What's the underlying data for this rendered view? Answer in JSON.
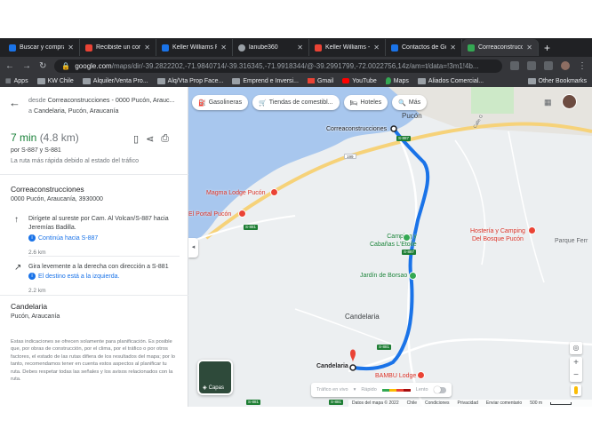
{
  "browser": {
    "tabs": [
      {
        "label": "Buscar y compra",
        "color": "#1a73e8"
      },
      {
        "label": "Recibiste un cor",
        "color": "#ea4335"
      },
      {
        "label": "Keller Williams R",
        "color": "#1a73e8"
      },
      {
        "label": "lanube360",
        "color": "#9aa0a6"
      },
      {
        "label": "Keller Williams -",
        "color": "#ea4335"
      },
      {
        "label": "Contactos de Go",
        "color": "#1a73e8"
      },
      {
        "label": "Correaconstrucc",
        "color": "#34a853"
      }
    ],
    "new_tab": "+",
    "url_host": "google.com",
    "url_path": "/maps/dir/-39.2822202,-71.9840714/-39.316345,-71.9918344/@-39.2991799,-72.0022756,14z/am=t/data=!3m1!4b...",
    "bookmarks": [
      {
        "label": "Apps",
        "icon": "apps-icon"
      },
      {
        "label": "KW Chile",
        "icon": "folder-icon"
      },
      {
        "label": "Alquiler/Venta Pro...",
        "icon": "folder-icon"
      },
      {
        "label": "Alq/Vta Prop Face...",
        "icon": "folder-icon"
      },
      {
        "label": "Emprend e Inversi...",
        "icon": "folder-icon"
      },
      {
        "label": "Gmail",
        "icon": "gmail-icon"
      },
      {
        "label": "YouTube",
        "icon": "youtube-icon"
      },
      {
        "label": "Maps",
        "icon": "maps-icon"
      },
      {
        "label": "Aliados Comercial...",
        "icon": "folder-icon"
      }
    ],
    "other_bookmarks": "Other Bookmarks"
  },
  "panel": {
    "route_prefix": "desde ",
    "route_origin": "Correaconstrucciones - 0000 Pucón, Arauc...",
    "route_mid": " a ",
    "route_destination": "Candelaria, Pucón, Araucanía",
    "duration": "7 min",
    "distance": "(4.8 km)",
    "via": "por S-887 y S-881",
    "faster_note": "La ruta más rápida debido al estado del tráfico",
    "origin_name": "Correaconstrucciones",
    "origin_address": "0000 Pucón, Araucanía, 3930000",
    "steps": [
      {
        "icon": "↑",
        "text": "Dirígete al sureste por Cam. Al Volcan/S-887 hacia Jeremías Badilla.",
        "note": "Continúa hacia S-887",
        "distance": "2.6 km"
      },
      {
        "icon": "↗",
        "text": "Gira levemente a la derecha con dirección a S-881",
        "note": "El destino está a la izquierda.",
        "distance": "2.2 km"
      }
    ],
    "destination_name": "Candelaria",
    "destination_address": "Pucón, Araucanía",
    "disclaimer": "Estas indicaciones se ofrecen solamente para planificación. Es posible que, por obras de construcción, por el clima, por el tráfico o por otros factores, el estado de las rutas difiera de los resultados del mapa; por lo tanto, recomendamos tener en cuenta estos aspectos al planificar tu ruta. Debes respetar todas las señales y los avisos relacionados con la ruta."
  },
  "map": {
    "chips": [
      {
        "label": "Gasolineras",
        "icon": "gas-station-icon"
      },
      {
        "label": "Tiendas de comestibl...",
        "icon": "cart-icon"
      },
      {
        "label": "Hoteles",
        "icon": "bed-icon"
      },
      {
        "label": "Más",
        "icon": "search-icon"
      }
    ],
    "labels": {
      "pucon": "Pucón",
      "correa": "Correaconstrucciones",
      "magma": "Magma Lodge Pucón",
      "portal": "El Portal Pucón",
      "camping": "Camping y\nCabañas L'Etoile",
      "jardin": "Jardín de Borsao",
      "hosteria": "Hostería y Camping\nDel Bosque Pucón",
      "parque": "Parque Ferr",
      "candelaria_town": "Candelaria",
      "candelaria_dest": "Candelaria",
      "bambu": "BAMBU Lodge",
      "calle_g": "Calle G"
    },
    "shields": {
      "s887": "S-887",
      "s881": "S-881",
      "r199": "199"
    },
    "layers_label": "Capas",
    "traffic_label": "Tráfico en vivo",
    "traffic_fast": "Rápido",
    "traffic_slow": "Lento",
    "zoom_in": "+",
    "zoom_out": "−",
    "footer": {
      "data": "Datos del mapa © 2022",
      "chile": "Chile",
      "conditions": "Condiciones",
      "privacy": "Privacidad",
      "feedback": "Enviar comentario",
      "scale": "500 m"
    },
    "colors": {
      "water": "#a8c7ee",
      "land": "#eceff1",
      "route": "#1a73e8",
      "road": "#f6d279",
      "poi_red": "#ea4335",
      "poi_green": "#34a853"
    }
  }
}
